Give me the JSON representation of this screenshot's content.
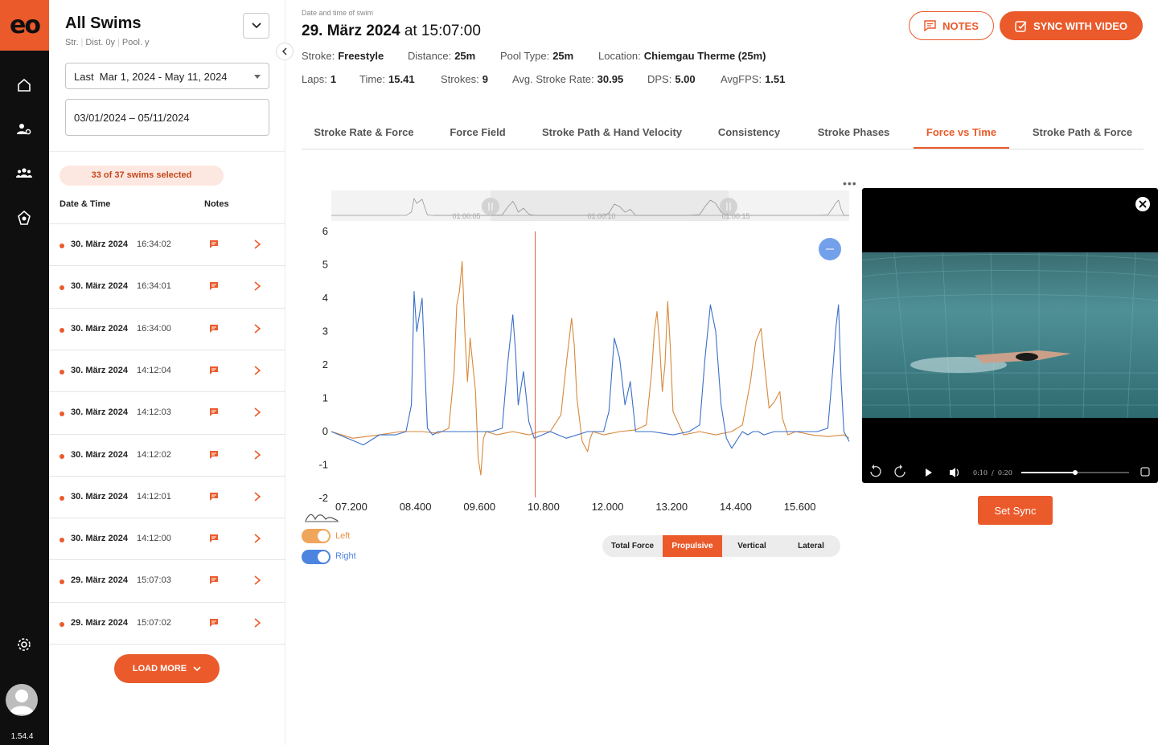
{
  "app": {
    "logo": "eo",
    "version": "1.54.4"
  },
  "rail": {
    "icons": [
      "home-icon",
      "user-settings-icon",
      "team-icon",
      "analytics-icon",
      "gear-icon",
      "user-avatar"
    ]
  },
  "sidebar": {
    "title": "All Swims",
    "subtitle": [
      "Str.",
      "Dist. 0y",
      "Pool. y"
    ],
    "date_select": "Last  Mar 1, 2024 - May 11, 2024",
    "date_range": "03/01/2024 – 05/11/2024",
    "selected_count": "33 of 37 swims selected",
    "col_date": "Date & Time",
    "col_notes": "Notes",
    "rows": [
      {
        "date": "30. März 2024",
        "time": "16:34:02"
      },
      {
        "date": "30. März 2024",
        "time": "16:34:01"
      },
      {
        "date": "30. März 2024",
        "time": "16:34:00"
      },
      {
        "date": "30. März 2024",
        "time": "14:12:04"
      },
      {
        "date": "30. März 2024",
        "time": "14:12:03"
      },
      {
        "date": "30. März 2024",
        "time": "14:12:02"
      },
      {
        "date": "30. März 2024",
        "time": "14:12:01"
      },
      {
        "date": "30. März 2024",
        "time": "14:12:00"
      },
      {
        "date": "29. März 2024",
        "time": "15:07:03"
      },
      {
        "date": "29. März 2024",
        "time": "15:07:02"
      }
    ],
    "load_more": "LOAD MORE"
  },
  "header": {
    "label": "Date and time of swim",
    "date": "29. März 2024",
    "at": "at 15:07:00",
    "stroke_label": "Stroke:",
    "stroke": "Freestyle",
    "distance_label": "Distance:",
    "distance": "25m",
    "pool_label": "Pool Type:",
    "pool": "25m",
    "location_label": "Location:",
    "location": "Chiemgau Therme (25m)",
    "laps_label": "Laps:",
    "laps": "1",
    "time_label": "Time:",
    "time": "15.41",
    "strokes_label": "Strokes:",
    "strokes": "9",
    "rate_label": "Avg. Stroke Rate:",
    "rate": "30.95",
    "dps_label": "DPS:",
    "dps": "5.00",
    "fps_label": "AvgFPS:",
    "fps": "1.51",
    "notes_btn": "NOTES",
    "sync_btn": "SYNC WITH VIDEO"
  },
  "tabs": [
    "Stroke Rate & Force",
    "Force Field",
    "Stroke Path & Hand Velocity",
    "Consistency",
    "Stroke Phases",
    "Force vs Time",
    "Stroke Path & Force"
  ],
  "active_tab": "Force vs Time",
  "chart_data": {
    "type": "line",
    "x_ticks": [
      "07.200",
      "08.400",
      "09.600",
      "10.800",
      "12.000",
      "13.200",
      "14.400",
      "15.600"
    ],
    "y_ticks": [
      "6",
      "5",
      "4",
      "3",
      "2",
      "1",
      "0",
      "-1",
      "-2"
    ],
    "ylim": [
      -2,
      6
    ],
    "xlim": [
      6.9,
      16.6
    ],
    "cursor_x": 10.72,
    "navigator_ticks": [
      "01:00:05",
      "01:00:10",
      "01:00:15"
    ],
    "series": [
      {
        "name": "Left",
        "color": "#d8883a",
        "x": [
          6.9,
          7.3,
          7.8,
          8.2,
          8.6,
          8.9,
          9.1,
          9.2,
          9.25,
          9.3,
          9.35,
          9.4,
          9.45,
          9.5,
          9.6,
          9.65,
          9.7,
          9.75,
          9.8,
          10.0,
          10.3,
          10.6,
          10.8,
          11.0,
          11.2,
          11.3,
          11.4,
          11.45,
          11.5,
          11.6,
          11.7,
          11.75,
          11.8,
          12.0,
          12.3,
          12.6,
          12.8,
          12.9,
          12.95,
          13.0,
          13.05,
          13.1,
          13.15,
          13.2,
          13.25,
          13.3,
          13.5,
          13.8,
          14.1,
          14.4,
          14.6,
          14.75,
          14.85,
          14.95,
          15.0,
          15.1,
          15.2,
          15.3,
          15.35,
          15.45,
          15.6,
          15.9,
          16.2,
          16.5,
          16.6
        ],
        "y": [
          0,
          -0.2,
          -0.1,
          0,
          0,
          -0.05,
          0.1,
          1.8,
          3.8,
          4.2,
          5.1,
          3.0,
          1.5,
          2.8,
          1.2,
          -0.8,
          -1.3,
          -0.2,
          0,
          -0.1,
          0,
          -0.1,
          0,
          0,
          0.5,
          2.0,
          3.4,
          2.6,
          1.0,
          -0.3,
          -0.6,
          -0.2,
          0,
          -0.1,
          0,
          0.05,
          0.2,
          1.8,
          3.0,
          3.6,
          2.6,
          1.2,
          2.0,
          3.9,
          2.5,
          0.6,
          -0.1,
          0,
          -0.1,
          0,
          0.2,
          1.5,
          2.7,
          3.1,
          2.2,
          0.7,
          0.9,
          1.2,
          0.4,
          -0.1,
          0,
          -0.1,
          -0.15,
          -0.1,
          -0.2
        ]
      },
      {
        "name": "Right",
        "color": "#3b6fc9",
        "x": [
          6.9,
          7.2,
          7.5,
          7.8,
          8.1,
          8.3,
          8.4,
          8.45,
          8.5,
          8.55,
          8.6,
          8.65,
          8.7,
          8.8,
          8.9,
          9.2,
          9.6,
          9.9,
          10.1,
          10.2,
          10.3,
          10.35,
          10.4,
          10.5,
          10.6,
          10.7,
          11.0,
          11.3,
          11.7,
          12.0,
          12.1,
          12.2,
          12.3,
          12.4,
          12.5,
          12.6,
          12.9,
          13.3,
          13.6,
          13.8,
          13.9,
          14.0,
          14.1,
          14.2,
          14.3,
          14.4,
          14.6,
          14.7,
          14.8,
          14.9,
          15.0,
          15.2,
          15.6,
          16.0,
          16.2,
          16.3,
          16.35,
          16.4,
          16.45,
          16.5,
          16.6
        ],
        "y": [
          0,
          -0.2,
          -0.4,
          -0.1,
          -0.1,
          0,
          0.8,
          4.2,
          3.0,
          3.5,
          4.0,
          2.0,
          0.1,
          -0.1,
          0,
          0,
          0,
          0,
          0.1,
          2.0,
          3.5,
          2.4,
          0.8,
          1.8,
          0.3,
          -0.2,
          0,
          -0.2,
          0,
          0,
          0.6,
          2.8,
          2.2,
          0.8,
          1.5,
          0,
          0,
          -0.1,
          0,
          0.2,
          2.2,
          3.8,
          3.0,
          0.8,
          -0.2,
          -0.5,
          0,
          -0.1,
          0,
          0,
          -0.1,
          0,
          0,
          0,
          0.1,
          2.0,
          3.1,
          3.8,
          1.5,
          0,
          -0.3
        ]
      }
    ],
    "legend": [
      "Left",
      "Right"
    ],
    "force_types": [
      "Total Force",
      "Propulsive",
      "Vertical",
      "Lateral"
    ],
    "active_force_type": "Propulsive"
  },
  "video": {
    "time_current": "0:10",
    "time_total": "0:20",
    "progress": 0.5,
    "set_sync": "Set Sync"
  },
  "colors": {
    "accent": "#ea5a2b",
    "left": "#d8883a",
    "right": "#3b6fc9"
  }
}
